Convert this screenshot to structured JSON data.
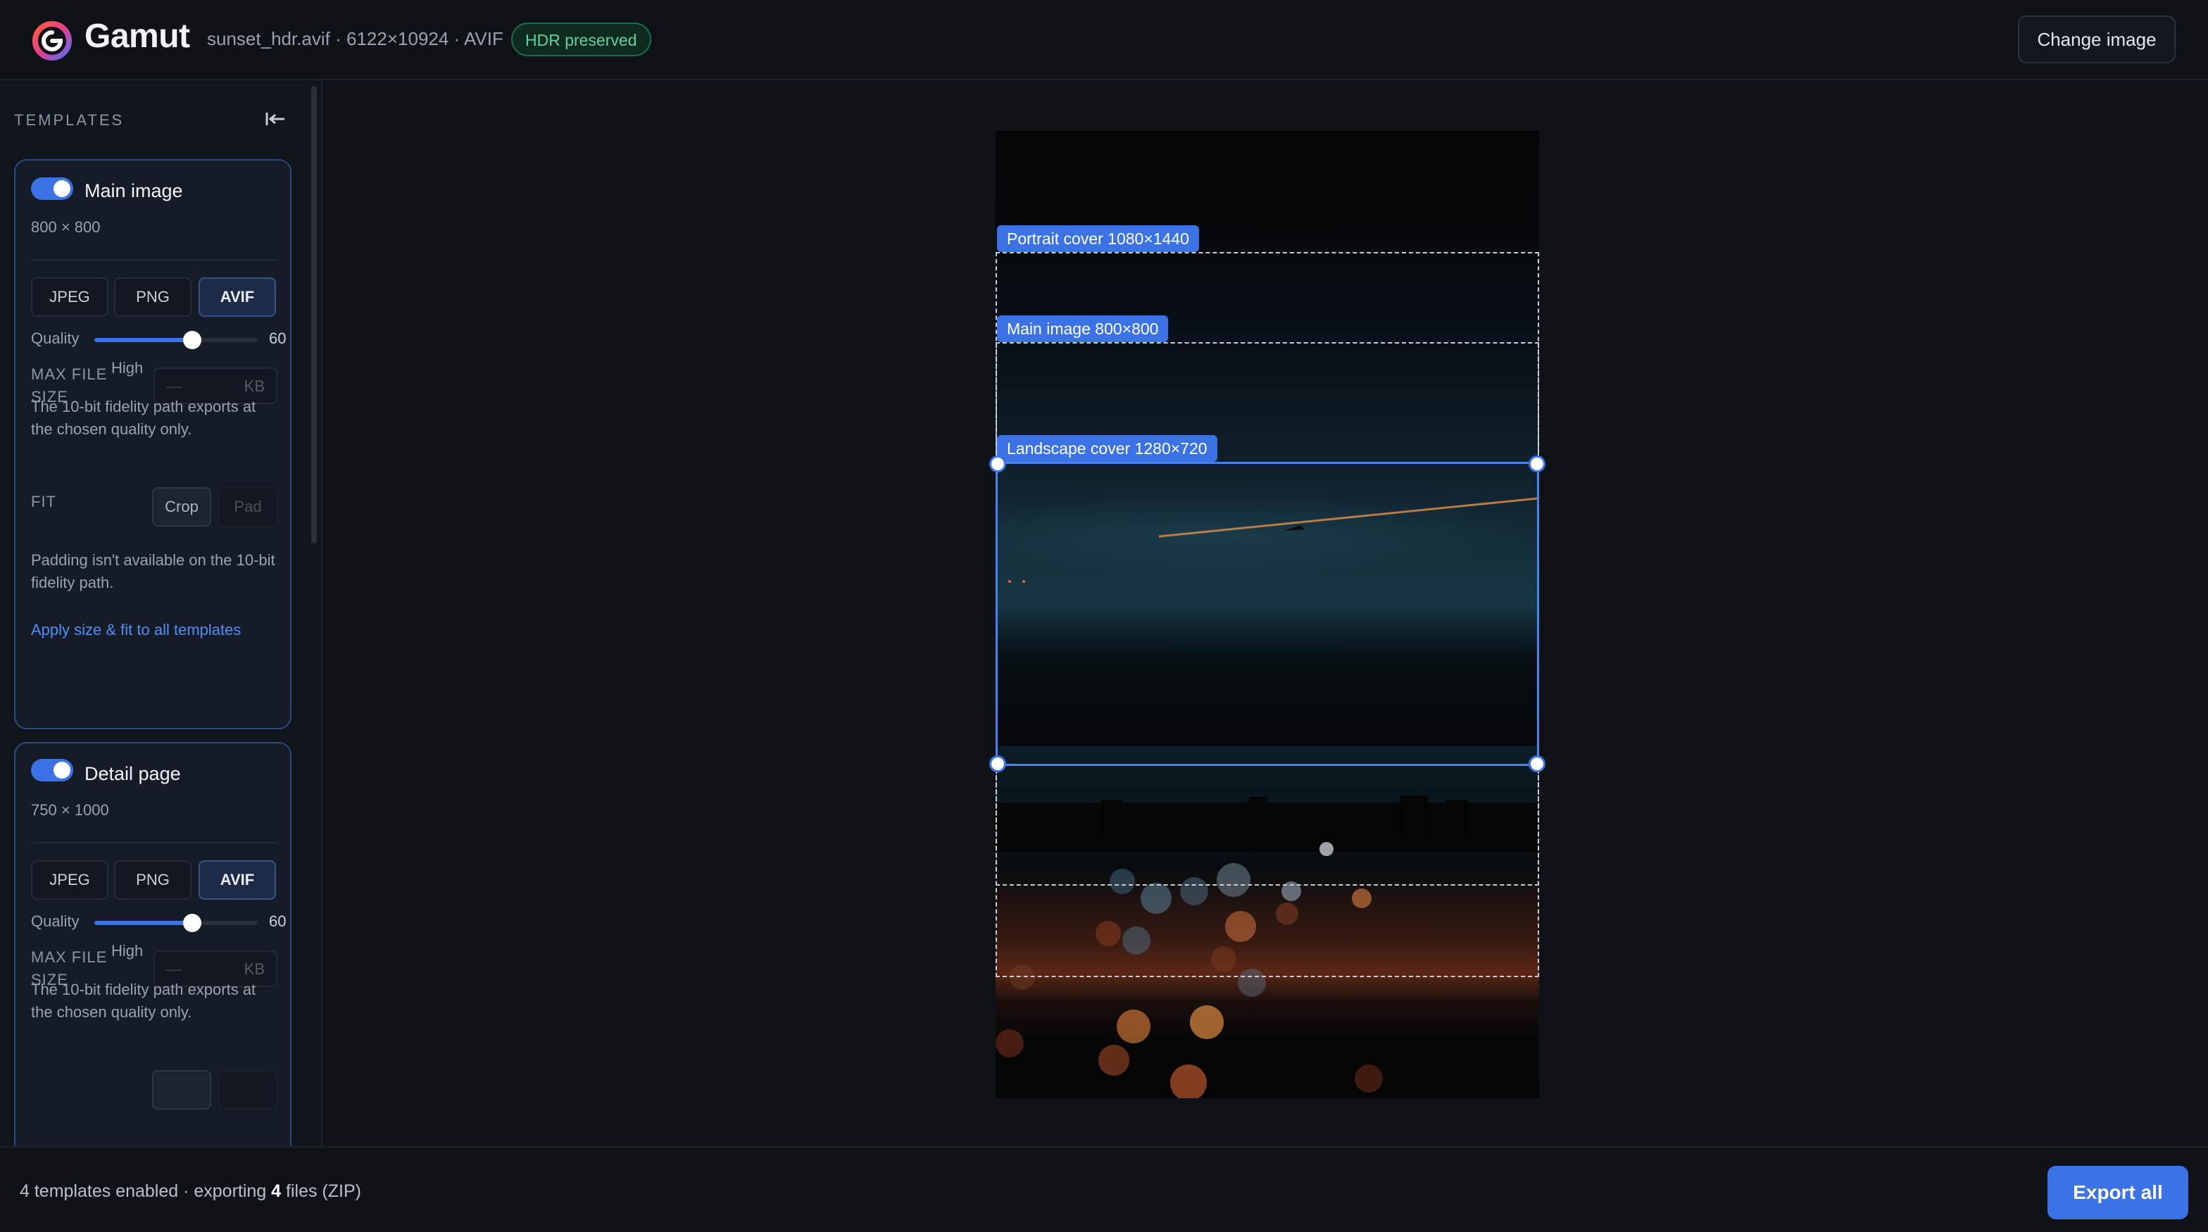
{
  "app": {
    "name": "Gamut",
    "logo_icon": "gamut-logo-icon",
    "file_info": "sunset_hdr.avif · 6122×10924 · AVIF",
    "hdr_badge": "HDR preserved",
    "change_image_label": "Change image"
  },
  "sidebar": {
    "title": "TEMPLATES",
    "collapse_icon": "collapse-left-icon",
    "templates": [
      {
        "name": "Main image",
        "enabled": true,
        "dimensions": "800 × 800",
        "formats": [
          "JPEG",
          "PNG",
          "AVIF"
        ],
        "selected_format": "AVIF",
        "quality_label": "Quality",
        "quality": 60,
        "quality_level": "High",
        "max_file_size_label": "MAX FILE SIZE",
        "max_file_size_placeholder": "—",
        "max_file_size_unit": "KB",
        "fidelity_note": "The 10-bit fidelity path exports at the chosen quality only.",
        "fit_label": "FIT",
        "fit_options": [
          "Crop",
          "Pad"
        ],
        "selected_fit": "Crop",
        "padding_note": "Padding isn't available on the 10-bit fidelity path.",
        "apply_link": "Apply size & fit to all templates"
      },
      {
        "name": "Detail page",
        "enabled": true,
        "dimensions": "750 × 1000",
        "formats": [
          "JPEG",
          "PNG",
          "AVIF"
        ],
        "selected_format": "AVIF",
        "quality_label": "Quality",
        "quality": 60,
        "quality_level": "High",
        "max_file_size_label": "MAX FILE SIZE",
        "max_file_size_placeholder": "—",
        "max_file_size_unit": "KB",
        "fidelity_note": "The 10-bit fidelity path exports at the chosen quality only."
      }
    ]
  },
  "canvas": {
    "crop_labels": {
      "portrait": "Portrait cover 1080×1440",
      "main": "Main image 800×800",
      "landscape": "Landscape cover 1280×720"
    },
    "active_crop": "Landscape cover 1280×720"
  },
  "footer": {
    "status_prefix": "4 templates enabled · exporting ",
    "file_count": "4",
    "status_suffix": " files (ZIP)",
    "export_label": "Export all"
  },
  "colors": {
    "accent": "#3b73e6",
    "hdr_green": "#5fd39b",
    "background": "#101319"
  }
}
